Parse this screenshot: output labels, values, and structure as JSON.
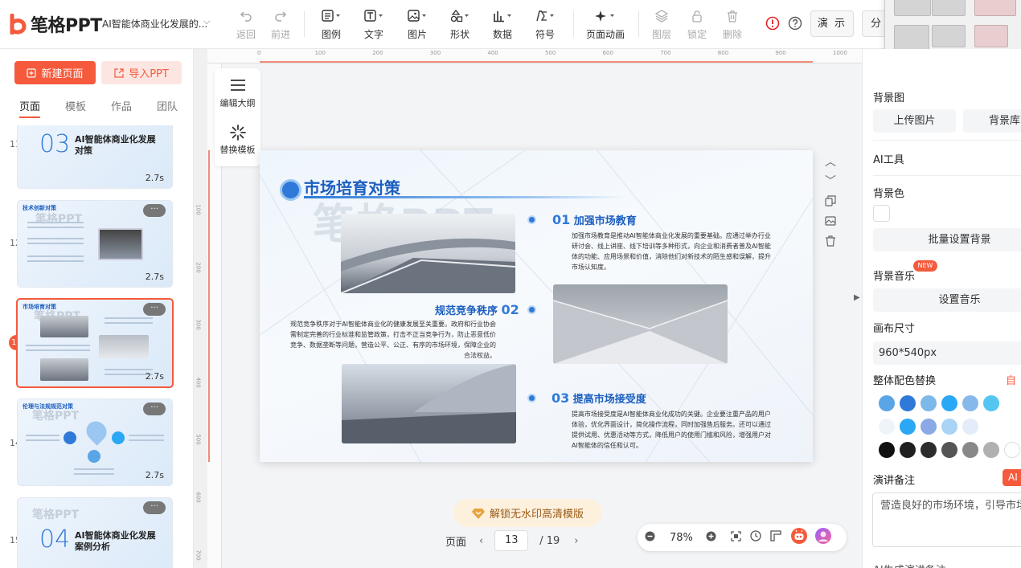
{
  "app": {
    "logo_text": "笔格PPT",
    "doc_title": "AI智能体商业化发展的..."
  },
  "toolbar": {
    "undo": "返回",
    "redo": "前进",
    "legend": "图例",
    "text": "文字",
    "image": "图片",
    "shape": "形状",
    "data": "数据",
    "symbol": "符号",
    "page_anim": "页面动画",
    "layer": "图层",
    "lock": "锁定",
    "delete": "删除",
    "present": "演 示",
    "share": "分"
  },
  "left": {
    "new_page": "新建页面",
    "import_ppt": "导入PPT",
    "tabs": [
      "页面",
      "模板",
      "作品",
      "团队"
    ],
    "thumbs": [
      {
        "num": "11",
        "big": "03",
        "title": "AI智能体商业化发展对策",
        "dur": "2.7s"
      },
      {
        "num": "12",
        "title": "技术创新对策",
        "dur": "2.7s"
      },
      {
        "num": "13",
        "title": "市场培育对策",
        "dur": "2.7s"
      },
      {
        "num": "14",
        "title": "伦理与法规规范对策",
        "dur": "2.7s"
      },
      {
        "num": "15",
        "big": "04",
        "title": "AI智能体商业化发展案例分析"
      }
    ],
    "more": "···"
  },
  "canvas": {
    "ruler_h": [
      "0",
      "100",
      "200",
      "300",
      "400",
      "500",
      "600",
      "700",
      "800",
      "900",
      "1000"
    ],
    "ruler_v": [
      "100",
      "200",
      "300",
      "400",
      "500",
      "600",
      "700"
    ],
    "side_outline": "编辑大纲",
    "side_template": "替换模板",
    "unlock": "解锁无水印高清模版",
    "page_label": "页面",
    "page_current": "13",
    "page_total": "/ 19",
    "zoom": "78%"
  },
  "slide": {
    "title": "市场培育对策",
    "watermark": "笔格PPT",
    "sec1_num": "01",
    "sec1_title": "加强市场教育",
    "sec1_text": "加强市场教育是推动AI智能体商业化发展的重要基础。应通过举办行业研讨会、线上讲座、线下培训等多种形式，向企业和消费者普及AI智能体的功能、应用场景和价值，消除他们对新技术的陌生感和误解，提升市场认知度。",
    "sec2_num": "02",
    "sec2_title": "规范竞争秩序",
    "sec2_text": "规范竞争秩序对于AI智能体商业化的健康发展至关重要。政府和行业协会需制定完善的行业标准和监管政策，打击不正当竞争行为，防止恶意低价竞争、数据垄断等问题，营造公平、公正、有序的市场环境，保障企业的合法权益。",
    "sec3_num": "03",
    "sec3_title": "提高市场接受度",
    "sec3_text": "提高市场接受度是AI智能体商业化成功的关键。企业要注重产品的用户体验，优化界面设计，简化操作流程，同时加强售后服务。还可以通过提供试用、优惠活动等方式，降低用户的使用门槛和风险，增强用户对AI智能体的信任和认可。"
  },
  "right": {
    "bg_image": "背景图",
    "upload_image": "上传图片",
    "bg_library": "背景库",
    "ai_tools": "AI工具",
    "bg_color": "背景色",
    "batch_bg": "批量设置背景",
    "bg_music": "背景音乐",
    "new_badge": "NEW",
    "set_music": "设置音乐",
    "canvas_size": "画布尺寸",
    "canvas_size_value": "960*540px",
    "color_replace": "整体配色替换",
    "color_replace_right": "自",
    "notes_label": "演讲备注",
    "ai_label": "AI",
    "notes_text": "营造良好的市场环境，引导市场需求，促进AI智能体的广泛应用。",
    "bottom_cut": "AI生成演讲备注"
  },
  "colors": {
    "accent": "#f55a3c",
    "slide_blue": "#1c5fbf",
    "palette_row1": [
      "#5aa5e6",
      "#2f7ad8",
      "#7cb8ea",
      "#2aa8f5",
      "#86b9ea",
      "#55c6f2"
    ],
    "palette_row2": [
      "#eef4fa",
      "#2aa8f5",
      "#8aa9e6",
      "#a9d4f5",
      "#e3ecf8"
    ],
    "palette_row3": [
      "#111111",
      "#1f1f1f",
      "#2d2d2d",
      "#555555",
      "#888888",
      "#b0b0b0",
      "#ffffff"
    ]
  }
}
